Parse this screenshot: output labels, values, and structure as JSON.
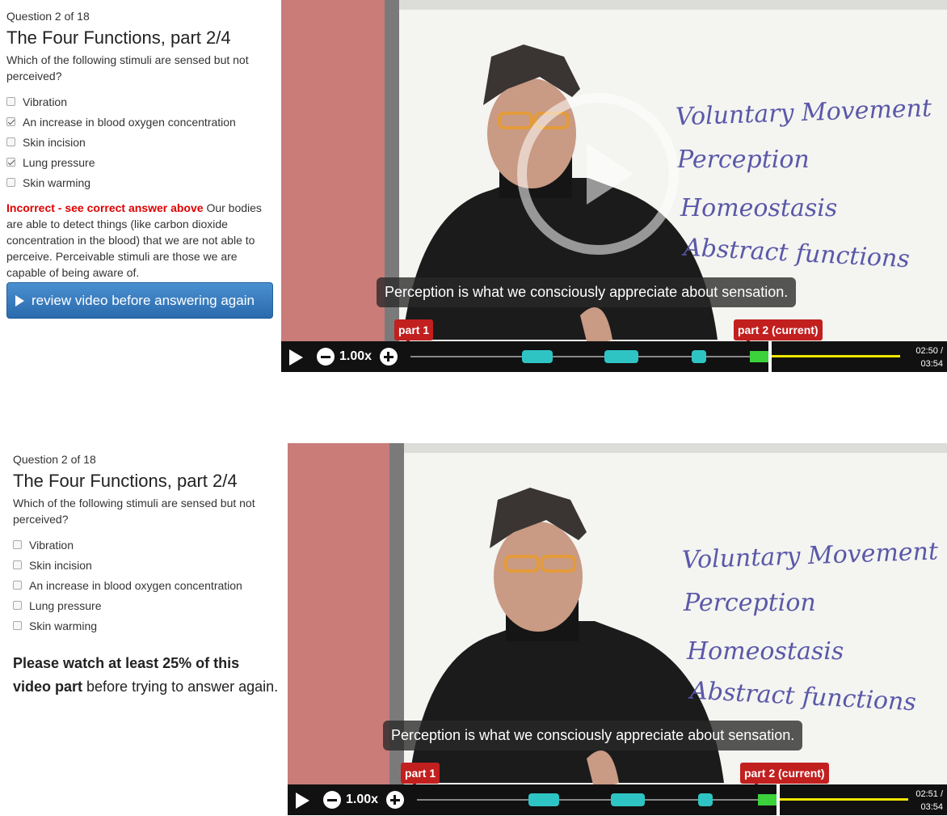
{
  "panels": [
    {
      "question_number": "Question 2 of 18",
      "title": "The Four Functions, part 2/4",
      "prompt": "Which of the following stimuli are sensed but not perceived?",
      "options": [
        {
          "label": "Vibration",
          "checked": false
        },
        {
          "label": "An increase in blood oxygen concentration",
          "checked": true
        },
        {
          "label": "Skin incision",
          "checked": false
        },
        {
          "label": "Lung pressure",
          "checked": true
        },
        {
          "label": "Skin warming",
          "checked": false
        }
      ],
      "feedback_incorrect": "Incorrect - see correct answer above",
      "feedback_text": "Our bodies are able to detect things (like carbon dioxide concentration in the blood) that we are not able to perceive. Perceivable stimuli are those we are capable of being aware of.",
      "review_button": "review video before answering again",
      "video": {
        "caption": "Perception is what we consciously appreciate about sensation.",
        "speed": "1.00x",
        "part1_label": "part 1",
        "part2_label": "part 2 (current)",
        "time_current": "02:50 /",
        "time_total": "03:54",
        "progress_fraction": 0.726,
        "whiteboard": [
          "Voluntary Movement",
          "Perception",
          "Homeostasis",
          "Abstract functions"
        ],
        "show_big_play": true
      }
    },
    {
      "question_number": "Question 2 of 18",
      "title": "The Four Functions, part 2/4",
      "prompt": "Which of the following stimuli are sensed but not perceived?",
      "options": [
        {
          "label": "Vibration",
          "checked": false
        },
        {
          "label": "Skin incision",
          "checked": false
        },
        {
          "label": "An increase in blood oxygen concentration",
          "checked": false
        },
        {
          "label": "Lung pressure",
          "checked": false
        },
        {
          "label": "Skin warming",
          "checked": false
        }
      ],
      "watch_bold": "Please watch at least 25% of this video part",
      "watch_rest": " before trying to answer again.",
      "video": {
        "caption": "Perception is what we consciously appreciate about sensation.",
        "speed": "1.00x",
        "part1_label": "part 1",
        "part2_label": "part 2 (current)",
        "time_current": "02:51 /",
        "time_total": "03:54",
        "progress_fraction": 0.731,
        "whiteboard": [
          "Voluntary Movement",
          "Perception",
          "Homeostasis",
          "Abstract functions"
        ],
        "show_big_play": false
      }
    }
  ]
}
